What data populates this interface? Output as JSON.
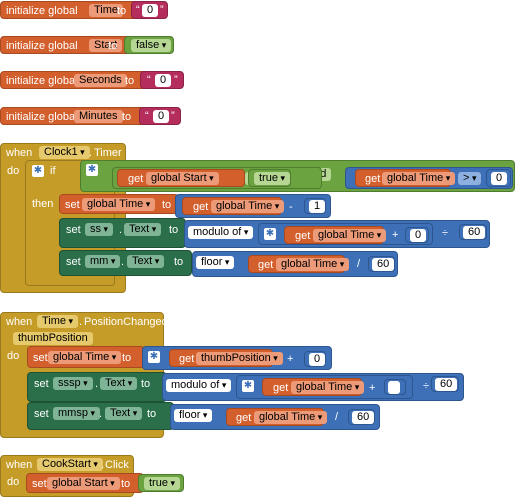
{
  "words": {
    "initialize_global": "initialize global",
    "to": "to",
    "when": "when",
    "do": "do",
    "if": "if",
    "then": "then",
    "get": "get",
    "set": "set",
    "and": "and",
    "global": "global",
    "modulo_of": "modulo of",
    "floor": "floor",
    "dot": "."
  },
  "init_blocks": [
    {
      "name": "Time",
      "value": "0",
      "type": "text"
    },
    {
      "name": "Start",
      "value": "false",
      "type": "logic"
    },
    {
      "name": "Seconds",
      "value": "0",
      "type": "text"
    },
    {
      "name": "Minutes",
      "value": "0",
      "type": "text"
    }
  ],
  "clock_event": {
    "component": "Clock1",
    "event": "Timer",
    "cond_left": "global Start",
    "cond_op": "=",
    "cond_right": "true",
    "and_label": "and",
    "cond2_left": "global Time",
    "cond2_op": ">",
    "cond2_right": "0",
    "set_time_var": "global Time",
    "get_time": "global Time",
    "minus_op": "-",
    "minus_value": "1",
    "ss_component": "ss",
    "ss_prop": "Text",
    "ss_get": "global Time",
    "plus_op": "+",
    "plus_value": "0",
    "div_op": "÷",
    "div_value": "60",
    "mm_component": "mm",
    "mm_prop": "Text",
    "mm_get": "global Time",
    "slash_op": "/",
    "slash_value": "60"
  },
  "time_event": {
    "component": "Time",
    "event": "PositionChanged",
    "param": "thumbPosition",
    "set_var": "global Time",
    "get_param": "thumbPosition",
    "plus_op": "+",
    "plus_value": "0",
    "sssp_component": "sssp",
    "sssp_prop": "Text",
    "sssp_get": "global Time",
    "sssp_plus": "+",
    "sssp_plus_value": "",
    "sssp_div": "÷",
    "sssp_div_value": "60",
    "mmsp_component": "mmsp",
    "mmsp_prop": "Text",
    "mmsp_get": "global Time",
    "mmsp_slash": "/",
    "mmsp_slash_value": "60"
  },
  "cook_event": {
    "component": "CookStart",
    "event": "Click",
    "set_var": "global Start",
    "value": "true"
  }
}
